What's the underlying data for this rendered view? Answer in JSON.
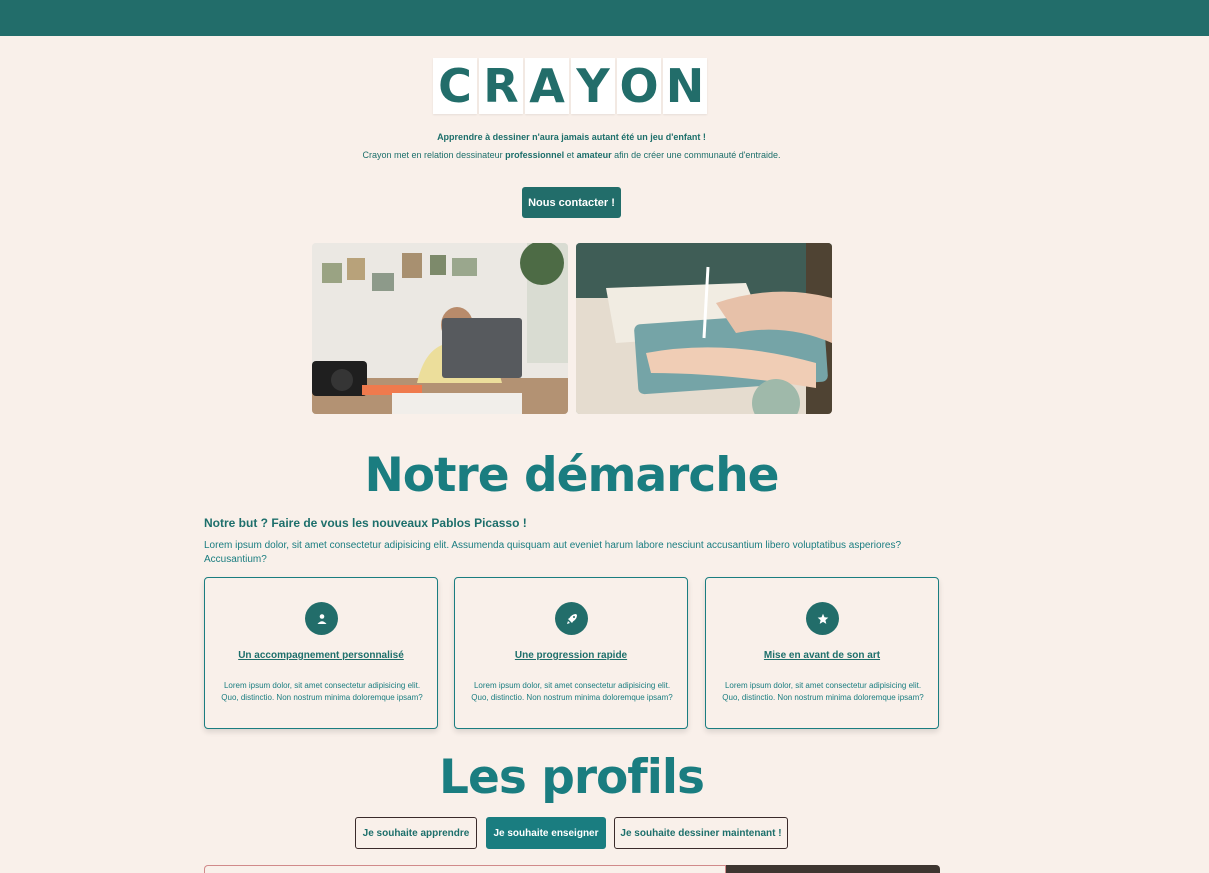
{
  "logo": {
    "letters": [
      "C",
      "R",
      "A",
      "Y",
      "O",
      "N"
    ]
  },
  "hero": {
    "tagline": "Apprendre à dessiner n'aura jamais autant été un jeu d'enfant !",
    "intro_prefix": "Crayon met en relation dessinateur ",
    "intro_professional": "professionnel",
    "intro_and": " et ",
    "intro_amateur": "amateur",
    "intro_suffix": " afin de créer une communauté d'entraide.",
    "contact_button": "Nous contacter !"
  },
  "approach": {
    "title": "Notre démarche",
    "subtitle": "Notre but ? Faire de vous les nouveaux Pablos Picasso !",
    "text": "Lorem ipsum dolor, sit amet consectetur adipisicing elit. Assumenda quisquam aut eveniet harum labore nesciunt accusantium libero voluptatibus asperiores? Accusantium?",
    "cards": [
      {
        "icon": "user-icon",
        "title": "Un accompagnement personnalisé",
        "text": "Lorem ipsum dolor, sit amet consectetur adipisicing elit. Quo, distinctio. Non nostrum minima doloremque ipsam?"
      },
      {
        "icon": "rocket-icon",
        "title": "Une progression rapide",
        "text": "Lorem ipsum dolor, sit amet consectetur adipisicing elit. Quo, distinctio. Non nostrum minima doloremque ipsam?"
      },
      {
        "icon": "star-icon",
        "title": "Mise en avant de son art",
        "text": "Lorem ipsum dolor, sit amet consectetur adipisicing elit. Quo, distinctio. Non nostrum minima doloremque ipsam?"
      }
    ]
  },
  "profiles": {
    "title": "Les profils",
    "tabs": [
      {
        "label": "Je souhaite apprendre",
        "active": false
      },
      {
        "label": "Je souhaite enseigner",
        "active": true
      },
      {
        "label": "Je souhaite dessiner maintenant !",
        "active": false
      }
    ]
  },
  "colors": {
    "primary": "#226d6a",
    "accent": "#1a7d80",
    "background": "#f9f0ea"
  }
}
